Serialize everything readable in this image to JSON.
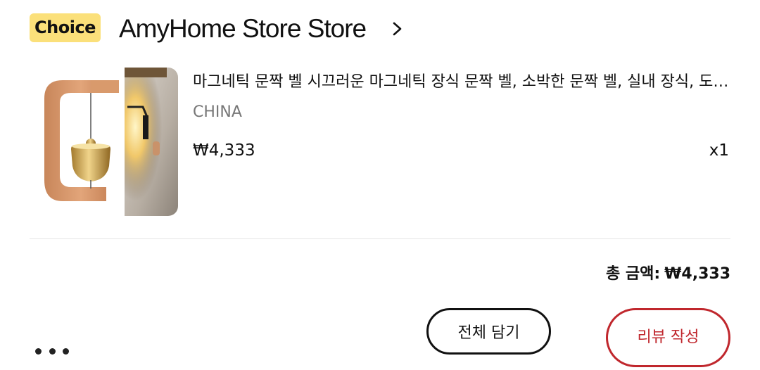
{
  "store": {
    "badge": "Choice",
    "name": "AmyHome Store Store",
    "chevron_icon": "chevron-right-icon"
  },
  "product": {
    "image_icon": "product-thumbnail",
    "title": "마그네틱 문짝 벨 시끄러운 마그네틱 장식 문짝 벨, 소박한 문짝 벨, 실내 장식, 도어벨",
    "origin": "CHINA",
    "price": "₩4,333",
    "quantity": "x1"
  },
  "summary": {
    "total_label": "총 금액:",
    "total_value": "₩4,333"
  },
  "actions": {
    "more_icon": "more-horizontal-icon",
    "add_all_label": "전체 담기",
    "write_review_label": "리뷰 작성"
  },
  "colors": {
    "badge_bg": "#fbe07a",
    "review_accent": "#c0272d",
    "muted_text": "#777777"
  }
}
